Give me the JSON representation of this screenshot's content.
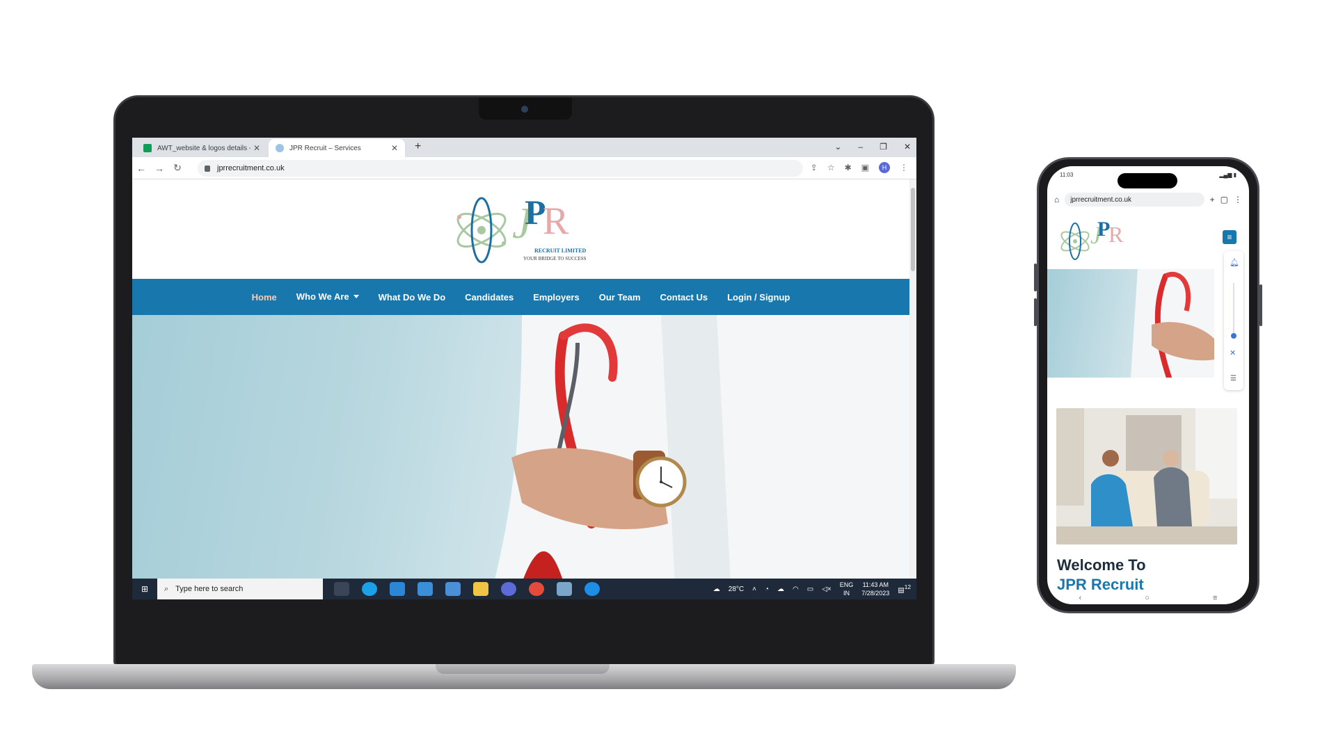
{
  "browser": {
    "tabs": [
      {
        "label": "AWT_website & logos details - G"
      },
      {
        "label": "JPR Recruit – Services"
      }
    ],
    "url": "jprrecruitment.co.uk",
    "profile_initial": "H"
  },
  "site": {
    "logo": {
      "letters": [
        "J",
        "P",
        "R"
      ],
      "line1": "RECRUIT LIMITED",
      "line2": "YOUR BRIDGE TO SUCCESS"
    },
    "nav": [
      {
        "label": "Home",
        "active": true
      },
      {
        "label": "Who We Are",
        "dropdown": true
      },
      {
        "label": "What Do We Do"
      },
      {
        "label": "Candidates"
      },
      {
        "label": "Employers"
      },
      {
        "label": "Our Team"
      },
      {
        "label": "Contact Us"
      },
      {
        "label": "Login / Signup"
      }
    ],
    "colors": {
      "nav_bg": "#1878ae",
      "active": "#ffc9b3",
      "heading": "#1d2d3c"
    }
  },
  "taskbar": {
    "search_placeholder": "Type here to search",
    "weather": "28°C",
    "lang1": "ENG",
    "lang2": "IN",
    "time": "11:43 AM",
    "date": "7/28/2023",
    "notifications": "12"
  },
  "phone": {
    "status_time": "11:03",
    "url": "jprrecruitment.co.uk",
    "welcome_line1": "Welcome To",
    "welcome_line2": "JPR Recruit"
  }
}
